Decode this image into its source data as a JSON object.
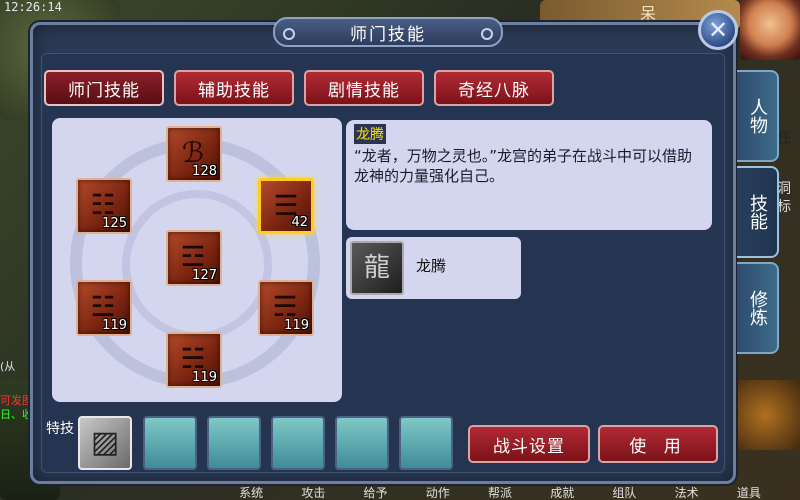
{
  "status_bar": {
    "clock": "12:26:14"
  },
  "dialog": {
    "title": "师门技能",
    "close_label": "✕",
    "tabs": [
      {
        "label": "师门技能",
        "active": true
      },
      {
        "label": "辅助技能",
        "active": false
      },
      {
        "label": "剧情技能",
        "active": false
      },
      {
        "label": "奇经八脉",
        "active": false
      }
    ],
    "skills": [
      {
        "name": "skill-top",
        "glyph": "ℬ",
        "level": "128",
        "selected": false
      },
      {
        "name": "skill-upper-left",
        "glyph": "☷",
        "level": "125",
        "selected": false
      },
      {
        "name": "skill-upper-right",
        "glyph": "☰",
        "level": "42",
        "selected": true
      },
      {
        "name": "skill-center",
        "glyph": "☲",
        "level": "127",
        "selected": false
      },
      {
        "name": "skill-lower-left",
        "glyph": "☳",
        "level": "119",
        "selected": false
      },
      {
        "name": "skill-lower-right",
        "glyph": "☴",
        "level": "119",
        "selected": false
      },
      {
        "name": "skill-bottom",
        "glyph": "☵",
        "level": "119",
        "selected": false
      }
    ],
    "description": {
      "title": "龙腾",
      "text": "“龙者，万物之灵也。”龙宫的弟子在战斗中可以借助龙神的力量强化自己。"
    },
    "effect": {
      "label": "龙腾",
      "icon": "dragon-icon",
      "glyph": "龍"
    },
    "special_label": "特技",
    "special_slot_glyph": "▨",
    "buttons": {
      "battle_settings": "战斗设置",
      "use": "使 用"
    },
    "side_tabs": [
      {
        "label": "人物",
        "active": false
      },
      {
        "label": "技能",
        "active": true
      },
      {
        "label": "修炼",
        "active": false
      }
    ]
  },
  "background": {
    "top_right_text": "呆",
    "left_texts": [
      "(从",
      "可发图",
      "日、收"
    ],
    "right_texts": [
      "任",
      "洞",
      "标"
    ],
    "bottom_menu": [
      "系统",
      "攻击",
      "给予",
      "动作",
      "帮派",
      "成就",
      "组队",
      "法术",
      "道具"
    ]
  }
}
